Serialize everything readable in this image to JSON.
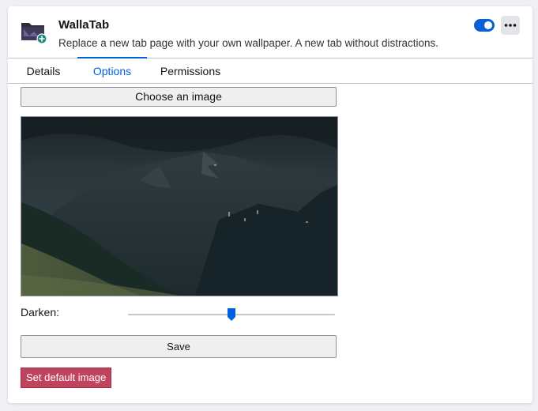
{
  "addon": {
    "name": "WallaTab",
    "description": "Replace a new tab page with your own wallpaper. A new tab without distractions.",
    "enabled": true
  },
  "tabs": [
    {
      "label": "Details",
      "active": false
    },
    {
      "label": "Options",
      "active": true
    },
    {
      "label": "Permissions",
      "active": false
    }
  ],
  "options": {
    "choose_label": "Choose an image",
    "darken_label": "Darken:",
    "darken_value": 0.5,
    "save_label": "Save",
    "default_label": "Set default image"
  },
  "colors": {
    "accent": "#0061e0",
    "toggle_on": "#0a5fd8",
    "danger_button": "#c0445e"
  },
  "icons": {
    "addon": "folder-plus-icon",
    "more": "more-horizontal-icon"
  }
}
